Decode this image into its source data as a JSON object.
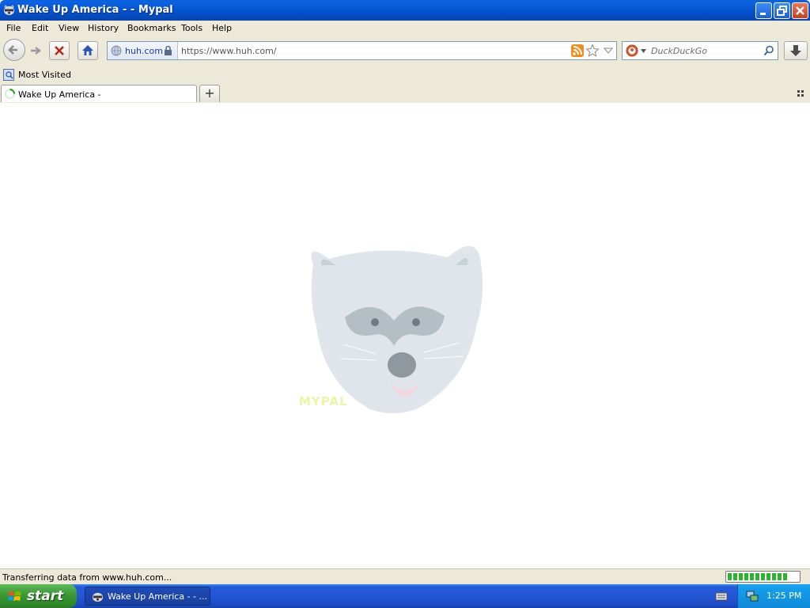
{
  "window": {
    "title": "Wake Up America - - Mypal"
  },
  "menu": {
    "items": [
      {
        "label": "File"
      },
      {
        "label": "Edit"
      },
      {
        "label": "View"
      },
      {
        "label": "History"
      },
      {
        "label": "Bookmarks"
      },
      {
        "label": "Tools"
      },
      {
        "label": "Help"
      }
    ]
  },
  "urlbar": {
    "identity": "huh.com",
    "url": "https://www.huh.com/"
  },
  "search": {
    "placeholder": "DuckDuckGo"
  },
  "bookmarks": {
    "most_visited": "Most Visited"
  },
  "tabs": [
    {
      "label": "Wake Up America -"
    }
  ],
  "newtab": {
    "label": "+"
  },
  "content": {
    "logo_text": "MYPAL"
  },
  "status": {
    "text": "Transferring data from www.huh.com...",
    "progress": 0.9
  },
  "taskbar": {
    "start": "start",
    "task_label": "Wake Up America - - ...",
    "clock": "1:25 PM"
  },
  "colors": {
    "accent": "#2456d4",
    "progress": "#2db42d"
  }
}
